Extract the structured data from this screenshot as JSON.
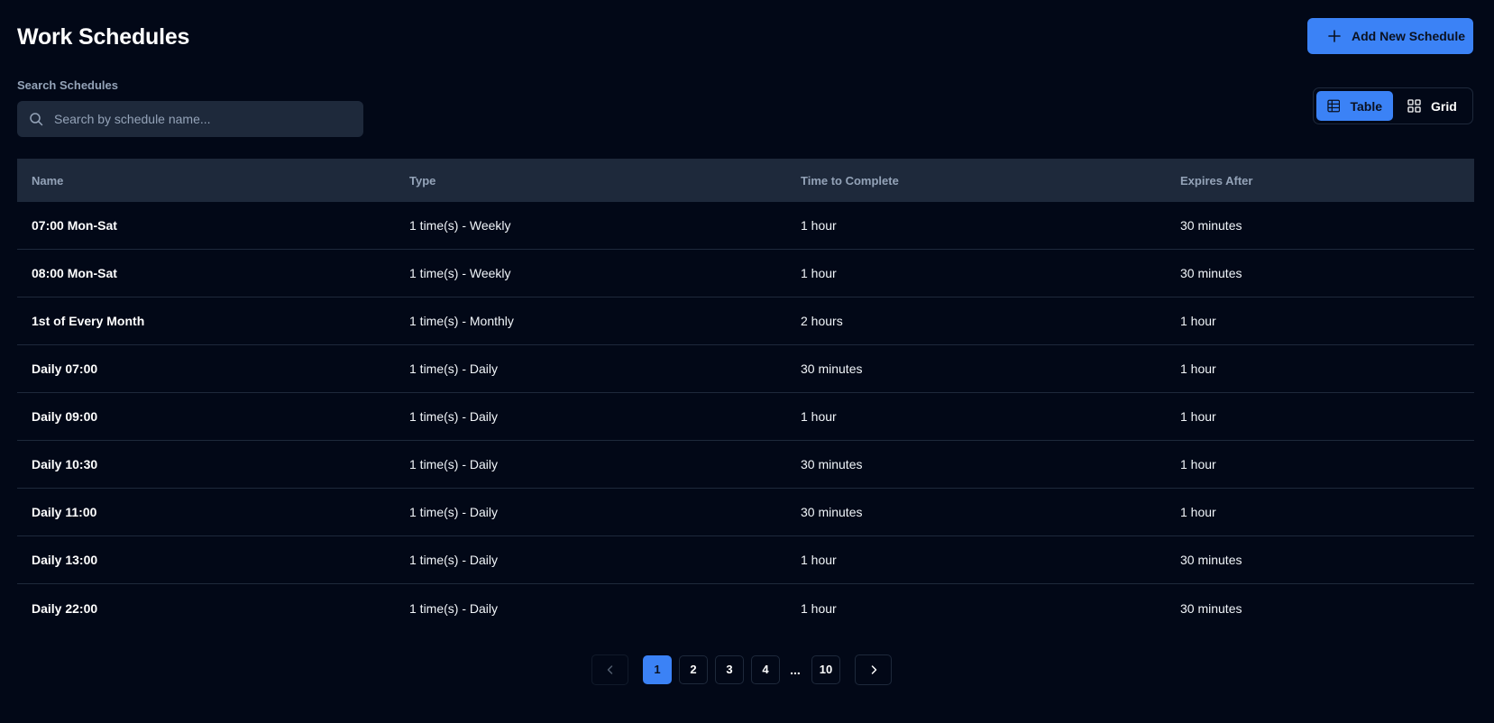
{
  "header": {
    "title": "Work Schedules",
    "add_button_label": "Add New Schedule"
  },
  "search": {
    "label": "Search Schedules",
    "placeholder": "Search by schedule name...",
    "value": ""
  },
  "view_toggle": {
    "table_label": "Table",
    "grid_label": "Grid",
    "active": "Table"
  },
  "table": {
    "columns": [
      "Name",
      "Type",
      "Time to Complete",
      "Expires After"
    ],
    "rows": [
      {
        "name": "07:00 Mon-Sat",
        "type": "1 time(s) - Weekly",
        "time_to_complete": "1 hour",
        "expires_after": "30 minutes"
      },
      {
        "name": "08:00 Mon-Sat",
        "type": "1 time(s) - Weekly",
        "time_to_complete": "1 hour",
        "expires_after": "30 minutes"
      },
      {
        "name": "1st of Every Month",
        "type": "1 time(s) - Monthly",
        "time_to_complete": "2 hours",
        "expires_after": "1 hour"
      },
      {
        "name": "Daily 07:00",
        "type": "1 time(s) - Daily",
        "time_to_complete": "30 minutes",
        "expires_after": "1 hour"
      },
      {
        "name": "Daily 09:00",
        "type": "1 time(s) - Daily",
        "time_to_complete": "1 hour",
        "expires_after": "1 hour"
      },
      {
        "name": "Daily 10:30",
        "type": "1 time(s) - Daily",
        "time_to_complete": "30 minutes",
        "expires_after": "1 hour"
      },
      {
        "name": "Daily 11:00",
        "type": "1 time(s) - Daily",
        "time_to_complete": "30 minutes",
        "expires_after": "1 hour"
      },
      {
        "name": "Daily 13:00",
        "type": "1 time(s) - Daily",
        "time_to_complete": "1 hour",
        "expires_after": "30 minutes"
      },
      {
        "name": "Daily 22:00",
        "type": "1 time(s) - Daily",
        "time_to_complete": "1 hour",
        "expires_after": "30 minutes"
      }
    ]
  },
  "pagination": {
    "pages": [
      "1",
      "2",
      "3",
      "4"
    ],
    "ellipsis": "...",
    "last_page": "10",
    "current": "1"
  },
  "icons": {
    "add": "plus-icon",
    "search": "search-icon",
    "table_view": "table-icon",
    "grid_view": "grid-icon",
    "prev": "chevron-left-icon",
    "next": "chevron-right-icon"
  },
  "colors": {
    "background": "#020817",
    "accent": "#3b82f6",
    "surface": "#1e293b",
    "muted_text": "#94a3b8"
  }
}
